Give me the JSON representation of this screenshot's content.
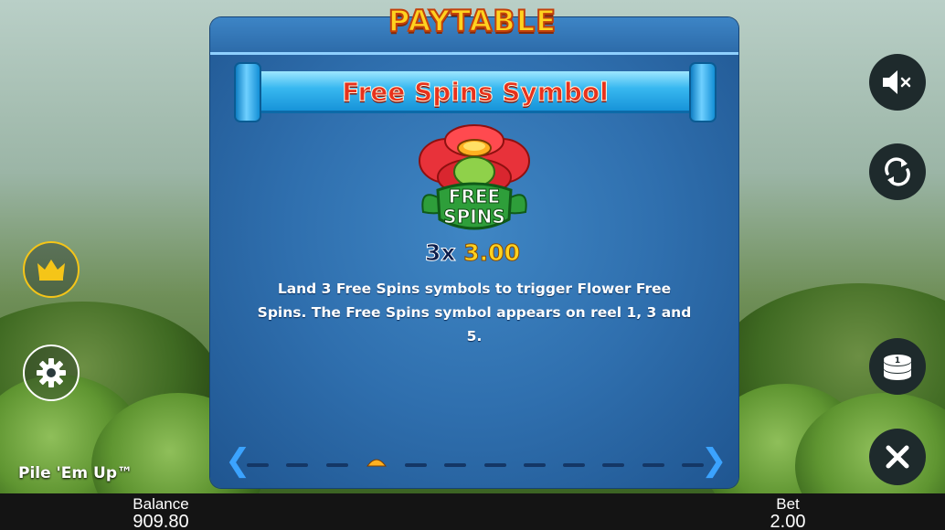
{
  "header": {
    "title": "PAYTABLE"
  },
  "section": {
    "title": "Free Spins Symbol"
  },
  "symbol": {
    "line1": "FREE",
    "line2": "SPINS",
    "icon": "free-spins-flower"
  },
  "payout": {
    "count": "3x",
    "value": "3.00"
  },
  "description": "Land 3 Free Spins symbols to trigger Flower Free Spins. The Free Spins symbol appears on reel 1, 3 and 5.",
  "pagination": {
    "pages": 12,
    "current": 4
  },
  "game": {
    "name": "Pile 'Em Up™"
  },
  "footer": {
    "balance_label": "Balance",
    "balance_value": "909.80",
    "bet_label": "Bet",
    "bet_value": "2.00"
  },
  "buttons": {
    "right": [
      "mute-icon",
      "autoplay-icon",
      "coins-icon",
      "close-icon"
    ],
    "left": [
      "crown-icon",
      "gear-icon"
    ]
  },
  "colors": {
    "accent_title": "#ffd21f",
    "section_title": "#e8321c",
    "panel": "#2f6fae",
    "arrow": "#3ba3ff",
    "crown": "#f5c518"
  }
}
